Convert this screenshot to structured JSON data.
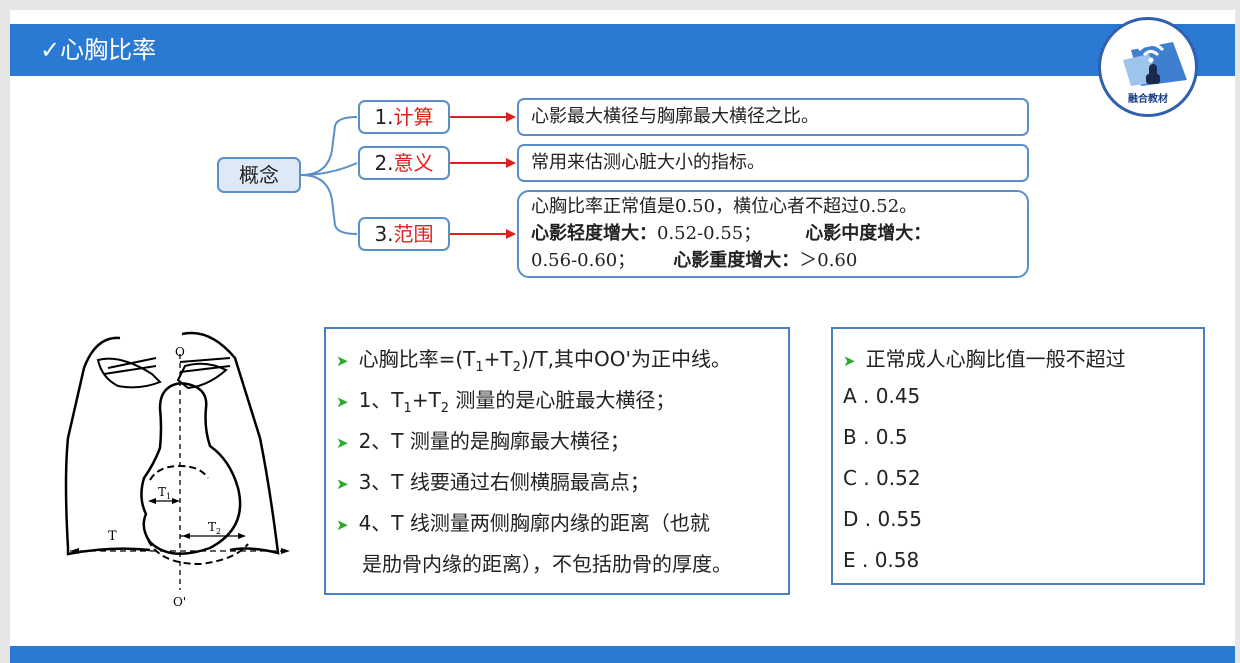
{
  "header": {
    "title": "✓心胸比率"
  },
  "logo": {
    "text": "融合教材"
  },
  "mindmap": {
    "concept": "概念",
    "branches": [
      {
        "num": "1.",
        "keyword": "计算",
        "lines": [
          "心影最大横径与胸廓最大横径之比。"
        ]
      },
      {
        "num": "2.",
        "keyword": "意义",
        "lines": [
          "常用来估测心脏大小的指标。"
        ]
      },
      {
        "num": "3.",
        "keyword": "范围",
        "line1": "心胸比率正常值是0.50，横位心者不超过0.52。",
        "mild_label": "心影轻度增大：",
        "mild_value": "0.52-0.55；",
        "moderate_label": "心影中度增大：",
        "moderate_value": "0.56-0.60；",
        "severe_label": "心影重度增大：",
        "severe_value": "＞0.60"
      }
    ]
  },
  "diagram": {
    "label_o": "O",
    "label_o_prime": "O'",
    "label_t": "T",
    "label_t1": "T",
    "label_t1_sub": "1",
    "label_t2": "T",
    "label_t2_sub": "2"
  },
  "notes": {
    "item0": {
      "a": "心胸比率=(T",
      "s1": "1",
      "b": "+T",
      "s2": "2",
      "c": ")/T,其中OO'为正中线。"
    },
    "item1": {
      "a": "1、T",
      "s1": "1",
      "b": "+T",
      "s2": "2",
      "c": " 测量的是心脏最大横径；"
    },
    "item2": "2、T 测量的是胸廓最大横径；",
    "item3": "3、T 线要通过右侧横膈最高点；",
    "item4a": "4、T 线测量两侧胸廓内缘的距离（也就",
    "item4b": "是肋骨内缘的距离），不包括肋骨的厚度。"
  },
  "question": {
    "stem": "正常成人心胸比值一般不超过",
    "options": [
      "A . 0.45",
      "B . 0.5",
      "C . 0.52",
      "D . 0.55",
      "E . 0.58"
    ]
  },
  "colors": {
    "header": "#2a7ad4",
    "accent_red": "#e0201e",
    "node_border": "#5b8fc8",
    "bullet_green": "#2ea82e"
  }
}
